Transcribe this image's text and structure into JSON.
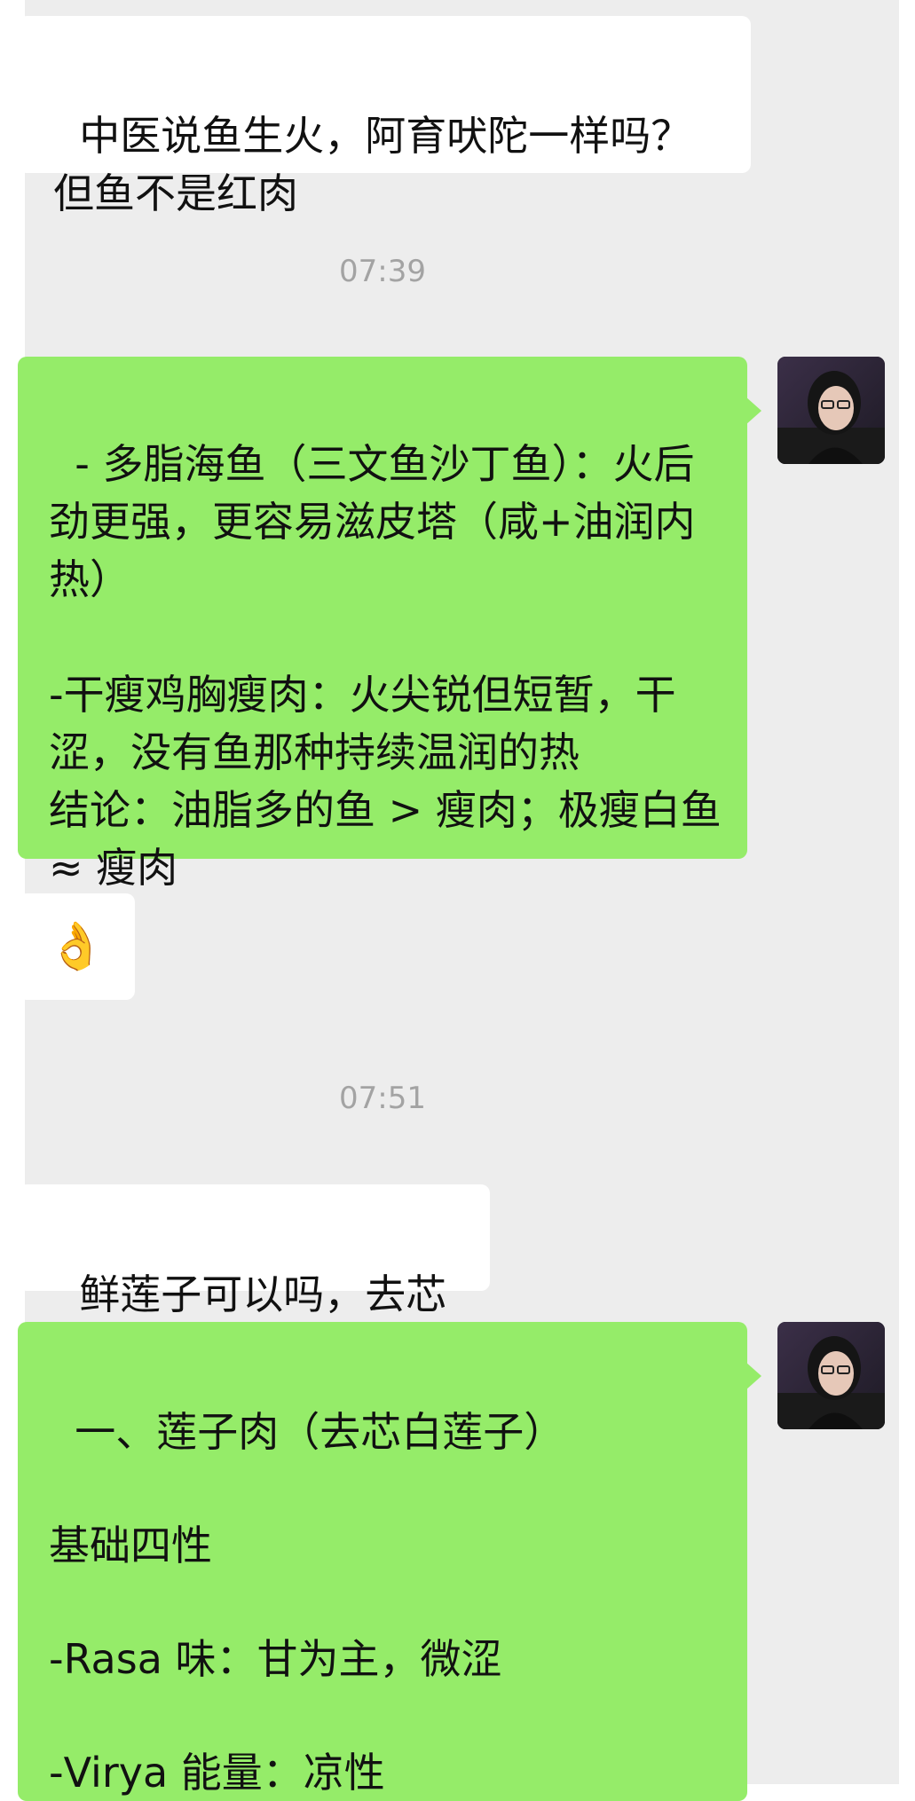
{
  "messages": [
    {
      "text": "中医说鱼生火，阿育吠陀一样吗？\n但鱼不是红肉"
    },
    {
      "timestamp": "07:39"
    },
    {
      "text": "- 多脂海鱼（三文鱼沙丁鱼）：火后劲更强，更容易滋皮塔（咸+油润内热）\n\n-干瘦鸡胸瘦肉：火尖锐但短暂，干涩，没有鱼那种持续温润的热\n结论：油脂多的鱼 > 瘦肉；极瘦白鱼 ≈ 瘦肉"
    },
    {
      "emoji": "👌"
    },
    {
      "timestamp": "07:51"
    },
    {
      "text": "鲜莲子可以吗，去芯"
    },
    {
      "text": "一、莲子肉（去芯白莲子）\n\n基础四性\n\n-Rasa 味：甘为主，微涩\n\n-Virya 能量：凉性"
    }
  ],
  "avatar": {
    "icon": "user-avatar-icon"
  },
  "colors": {
    "chat_background": "#ededed",
    "incoming_bubble": "#ffffff",
    "outgoing_bubble": "#95ec69",
    "timestamp_text": "#a3a3a3"
  }
}
